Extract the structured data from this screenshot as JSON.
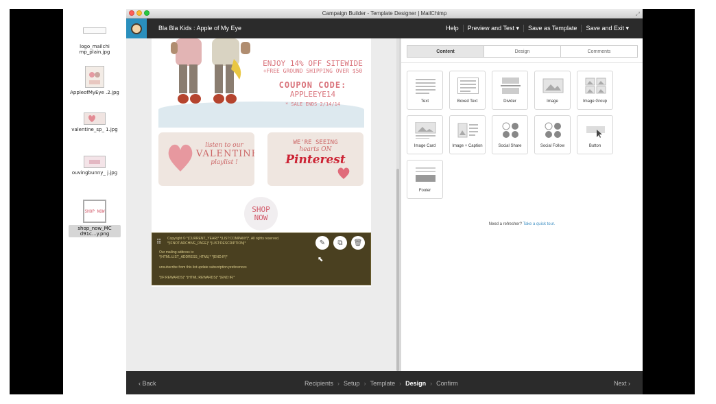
{
  "window": {
    "title": "Campaign Builder - Template Designer | MailChimp"
  },
  "desktop": {
    "icons": [
      {
        "label": "logo_mailchi mp_plain.jpg"
      },
      {
        "label": "AppleofMyEye .2.jpg"
      },
      {
        "label": "valentine_sp_ 1.jpg"
      },
      {
        "label": "ouvingbunny_ j.jpg"
      },
      {
        "label": "shop_now_MC d91c...y.png",
        "thumb_text": "SHOP NOW"
      }
    ]
  },
  "appbar": {
    "campaign_name": "Bla Bla Kids : Apple of My Eye",
    "help": "Help",
    "preview_test": "Preview and Test ▾",
    "save_template": "Save as Template",
    "save_exit": "Save and Exit ▾"
  },
  "email": {
    "promo": {
      "line1": "ENJOY 14% OFF SITEWIDE",
      "line2": "+FREE GROUND SHIPPING OVER $50",
      "line3": "COUPON CODE:",
      "line4": "APPLEEYE14",
      "line5": "* SALE ENDS 2/14/14"
    },
    "card1": {
      "line1": "listen to our",
      "line2": "VALENTINE",
      "line3": "playlist !"
    },
    "card2": {
      "line1": "WE'RE SEEING",
      "line2": "hearts ON",
      "line3": "Pinterest"
    },
    "shop": {
      "line1": "SHOP",
      "line2": "NOW"
    },
    "footer": {
      "line1": "Copyright © *|CURRENT_YEAR|* *|LIST:COMPANY|*, All rights reserved.",
      "line2": "*|IFNOT:ARCHIVE_PAGE|* *|LIST:DESCRIPTION|*",
      "line3": "Our mailing address is:",
      "line4": "*|HTML:LIST_ADDRESS_HTML|* *|END:IF|*",
      "line5": "unsubscribe from this list    update subscription preferences",
      "line6": "*|IF:REWARDS|* *|HTML:REWARDS|* *|END:IF|*"
    }
  },
  "content": {
    "tabs": [
      "Content",
      "Design",
      "Comments"
    ],
    "blocks": [
      {
        "label": "Text",
        "icon": "text-block-icon"
      },
      {
        "label": "Boxed Text",
        "icon": "boxed-text-icon"
      },
      {
        "label": "Divider",
        "icon": "divider-icon"
      },
      {
        "label": "Image",
        "icon": "image-icon"
      },
      {
        "label": "Image Group",
        "icon": "image-group-icon"
      },
      {
        "label": "Image Card",
        "icon": "image-card-icon"
      },
      {
        "label": "Image + Caption",
        "icon": "image-caption-icon"
      },
      {
        "label": "Social Share",
        "icon": "social-share-icon"
      },
      {
        "label": "Social Follow",
        "icon": "social-follow-icon"
      },
      {
        "label": "Button",
        "icon": "button-icon"
      },
      {
        "label": "Footer",
        "icon": "footer-icon"
      }
    ],
    "refresher_text": "Need a refresher?",
    "refresher_link": "Take a quick tour."
  },
  "bottom": {
    "back": "‹  Back",
    "steps": [
      "Recipients",
      "Setup",
      "Template",
      "Design",
      "Confirm"
    ],
    "current_step": "Design",
    "next": "Next  ›"
  }
}
